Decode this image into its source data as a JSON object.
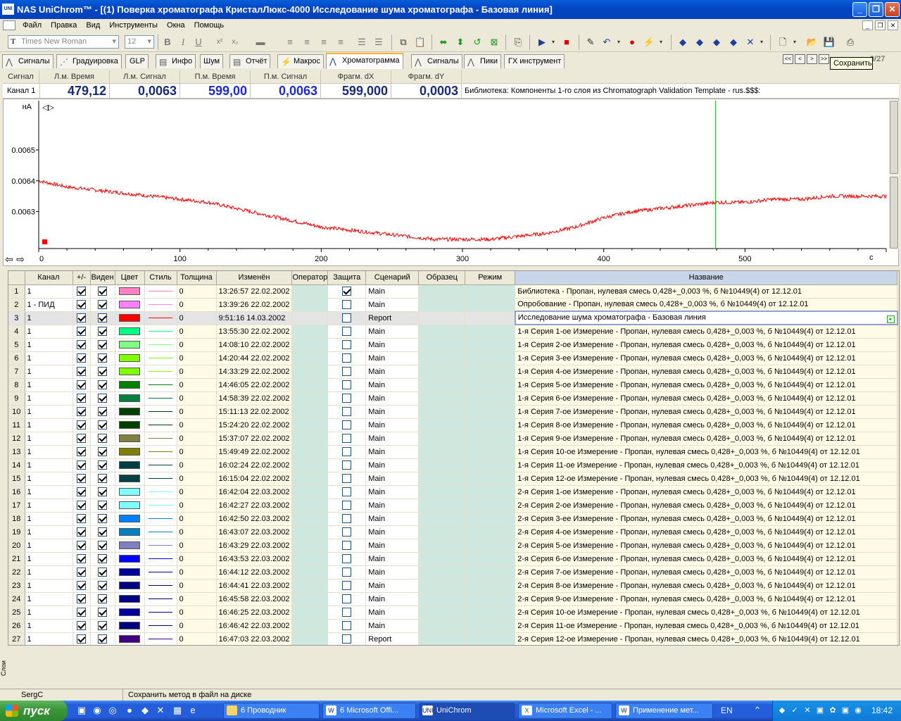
{
  "window": {
    "title": "NAS UniChrom™ - [(1) Поверка хроматографа КристалЛюкс-4000 Исследование шума хроматографа - Базовая линия]",
    "app_icon": "UNI"
  },
  "menu": [
    "Файл",
    "Правка",
    "Вид",
    "Инструменты",
    "Окна",
    "Помощь"
  ],
  "toolbar": {
    "font": "Times New Roman",
    "size": "12"
  },
  "tabs": [
    "Сигналы",
    "Градуировка",
    "GLP",
    "Инфо",
    "Шум",
    "Отчёт",
    "Макрос",
    "Хроматограмма",
    "Сигналы",
    "Пики",
    "ГХ инструмент"
  ],
  "active_tab": "Хроматограмма",
  "nav_buttons": [
    "<<",
    "<",
    ">",
    ">>"
  ],
  "tooltip": "Сохранить",
  "page_indicator": "3/27",
  "info": {
    "headers": [
      "Сигнал",
      "Л.м. Время",
      "Л.м. Сигнал",
      "П.м. Время",
      "П.м. Сигнал",
      "Фрагм. dX",
      "Фрагм. dY"
    ],
    "channel": "Канал 1",
    "lm_time": "479,12",
    "lm_signal": "0,0063",
    "pm_time": "599,00",
    "pm_signal": "0,0063",
    "frag_dx": "599,000",
    "frag_dy": "0,0003",
    "library": "Библиотека: Компоненты 1-го слоя из Chromatograph Validation Template - rus.$$$:"
  },
  "chart_data": {
    "type": "line",
    "ylabel": "нА",
    "xlabel": "c",
    "xlim": [
      0,
      600
    ],
    "ylim": [
      0.00618,
      0.00666
    ],
    "yticks": [
      "0.0065",
      "0.0064",
      "0.0063"
    ],
    "ytick_values": [
      0.0065,
      0.0064,
      0.0063
    ],
    "xticks": [
      "0",
      "100",
      "200",
      "300",
      "400",
      "500"
    ],
    "xtick_values": [
      0,
      100,
      200,
      300,
      400,
      500
    ],
    "cursor_x": 479.12,
    "series": [
      {
        "color": "#ff0000",
        "x": [
          0,
          20,
          40,
          60,
          80,
          100,
          120,
          140,
          160,
          180,
          200,
          220,
          240,
          260,
          280,
          300,
          320,
          340,
          360,
          380,
          400,
          420,
          440,
          460,
          480,
          500,
          520,
          540,
          560,
          580,
          600
        ],
        "y": [
          0.0064,
          0.00638,
          0.00637,
          0.00636,
          0.00635,
          0.00634,
          0.00633,
          0.00631,
          0.00629,
          0.00627,
          0.00625,
          0.00624,
          0.00623,
          0.00622,
          0.00621,
          0.00621,
          0.00621,
          0.00622,
          0.00623,
          0.00625,
          0.00628,
          0.0063,
          0.00631,
          0.00632,
          0.00633,
          0.00633,
          0.00634,
          0.00634,
          0.00635,
          0.00635,
          0.00635
        ]
      }
    ]
  },
  "grid": {
    "headers": [
      "",
      "Канал",
      "+/-",
      "Виден",
      "Цвет",
      "Стиль",
      "Толщина",
      "Изменён",
      "Оператор",
      "Защита",
      "Сценарий",
      "Образец",
      "Режим",
      "Название"
    ],
    "rows": [
      {
        "n": "1",
        "ch": "1",
        "pm": true,
        "vis": true,
        "color": "#ff80c0",
        "w": "0",
        "date": "13:26:57 22.02.2002",
        "prot": true,
        "scen": "Main",
        "name": "Библиотека - Пропан, нулевая смесь 0,428+_0,003 %, б №10449(4) от 12.12.01"
      },
      {
        "n": "2",
        "ch": "1 - ПИД",
        "pm": true,
        "vis": true,
        "color": "#ff80ff",
        "w": "0",
        "date": "13:39:26 22.02.2002",
        "prot": false,
        "scen": "Main",
        "name": "Опробование - Пропан, нулевая смесь 0,428+_0,003 %, б №10449(4) от 12.12.01"
      },
      {
        "n": "3",
        "ch": "1",
        "pm": true,
        "vis": true,
        "color": "#ff0000",
        "w": "0",
        "date": "9:51:16 14.03.2002",
        "prot": false,
        "scen": "Report",
        "name": "Исследование шума хроматографа - Базовая линия"
      },
      {
        "n": "4",
        "ch": "1",
        "pm": true,
        "vis": true,
        "color": "#00ff80",
        "w": "0",
        "date": "13:55:30 22.02.2002",
        "prot": false,
        "scen": "Main",
        "name": "1-я Серия 1-ое Измерение - Пропан, нулевая смесь 0,428+_0,003 %, б №10449(4) от 12.12.01"
      },
      {
        "n": "5",
        "ch": "1",
        "pm": true,
        "vis": true,
        "color": "#80ff80",
        "w": "0",
        "date": "14:08:10 22.02.2002",
        "prot": false,
        "scen": "Main",
        "name": "1-я Серия 2-ое Измерение - Пропан, нулевая смесь 0,428+_0,003 %, б №10449(4) от 12.12.01"
      },
      {
        "n": "6",
        "ch": "1",
        "pm": true,
        "vis": true,
        "color": "#80ff00",
        "w": "0",
        "date": "14:20:44 22.02.2002",
        "prot": false,
        "scen": "Main",
        "name": "1-я Серия 3-ее Измерение - Пропан, нулевая смесь 0,428+_0,003 %, б №10449(4) от 12.12.01"
      },
      {
        "n": "7",
        "ch": "1",
        "pm": true,
        "vis": true,
        "color": "#80ff00",
        "w": "0",
        "date": "14:33:29 22.02.2002",
        "prot": false,
        "scen": "Main",
        "name": "1-я Серия 4-ое Измерение - Пропан, нулевая смесь 0,428+_0,003 %, б №10449(4) от 12.12.01"
      },
      {
        "n": "8",
        "ch": "1",
        "pm": true,
        "vis": true,
        "color": "#008000",
        "w": "0",
        "date": "14:46:05 22.02.2002",
        "prot": false,
        "scen": "Main",
        "name": "1-я Серия 5-ое Измерение - Пропан, нулевая смесь 0,428+_0,003 %, б №10449(4) от 12.12.01"
      },
      {
        "n": "9",
        "ch": "1",
        "pm": true,
        "vis": true,
        "color": "#008040",
        "w": "0",
        "date": "14:58:39 22.02.2002",
        "prot": false,
        "scen": "Main",
        "name": "1-я Серия 6-ое Измерение - Пропан, нулевая смесь 0,428+_0,003 %, б №10449(4) от 12.12.01"
      },
      {
        "n": "10",
        "ch": "1",
        "pm": true,
        "vis": true,
        "color": "#004000",
        "w": "0",
        "date": "15:11:13 22.02.2002",
        "prot": false,
        "scen": "Main",
        "name": "1-я Серия 7-ое Измерение - Пропан, нулевая смесь 0,428+_0,003 %, б №10449(4) от 12.12.01"
      },
      {
        "n": "11",
        "ch": "1",
        "pm": true,
        "vis": true,
        "color": "#004000",
        "w": "0",
        "date": "15:24:20 22.02.2002",
        "prot": false,
        "scen": "Main",
        "name": "1-я Серия 8-ое Измерение - Пропан, нулевая смесь 0,428+_0,003 %, б №10449(4) от 12.12.01"
      },
      {
        "n": "12",
        "ch": "1",
        "pm": true,
        "vis": true,
        "color": "#808040",
        "w": "0",
        "date": "15:37:07 22.02.2002",
        "prot": false,
        "scen": "Main",
        "name": "1-я Серия 9-ое Измерение - Пропан, нулевая смесь 0,428+_0,003 %, б №10449(4) от 12.12.01"
      },
      {
        "n": "13",
        "ch": "1",
        "pm": true,
        "vis": true,
        "color": "#808000",
        "w": "0",
        "date": "15:49:49 22.02.2002",
        "prot": false,
        "scen": "Main",
        "name": "1-я Серия 10-ое Измерение - Пропан, нулевая смесь 0,428+_0,003 %, б №10449(4) от 12.12.01"
      },
      {
        "n": "14",
        "ch": "1",
        "pm": true,
        "vis": true,
        "color": "#004040",
        "w": "0",
        "date": "16:02:24 22.02.2002",
        "prot": false,
        "scen": "Main",
        "name": "1-я Серия 11-ое Измерение - Пропан, нулевая смесь 0,428+_0,003 %, б №10449(4) от 12.12.01"
      },
      {
        "n": "15",
        "ch": "1",
        "pm": true,
        "vis": true,
        "color": "#004040",
        "w": "0",
        "date": "16:15:04 22.02.2002",
        "prot": false,
        "scen": "Main",
        "name": "1-я Серия 12-ое Измерение - Пропан, нулевая смесь 0,428+_0,003 %, б №10449(4) от 12.12.01"
      },
      {
        "n": "16",
        "ch": "1",
        "pm": true,
        "vis": true,
        "color": "#80ffff",
        "w": "0",
        "date": "16:42:04 22.03.2002",
        "prot": false,
        "scen": "Main",
        "name": "2-я Серия 1-ое Измерение - Пропан, нулевая смесь 0,428+_0,003 %, б №10449(4) от 12.12.01"
      },
      {
        "n": "17",
        "ch": "1",
        "pm": true,
        "vis": true,
        "color": "#80ffff",
        "w": "0",
        "date": "16:42:27 22.03.2002",
        "prot": false,
        "scen": "Main",
        "name": "2-я Серия 2-ое Измерение - Пропан, нулевая смесь 0,428+_0,003 %, б №10449(4) от 12.12.01"
      },
      {
        "n": "18",
        "ch": "1",
        "pm": true,
        "vis": true,
        "color": "#0080ff",
        "w": "0",
        "date": "16:42:50 22.03.2002",
        "prot": false,
        "scen": "Main",
        "name": "2-я Серия 3-ее Измерение - Пропан, нулевая смесь 0,428+_0,003 %, б №10449(4) от 12.12.01"
      },
      {
        "n": "19",
        "ch": "1",
        "pm": true,
        "vis": true,
        "color": "#0080c0",
        "w": "0",
        "date": "16:43:07 22.03.2002",
        "prot": false,
        "scen": "Main",
        "name": "2-я Серия 4-ое Измерение - Пропан, нулевая смесь 0,428+_0,003 %, б №10449(4) от 12.12.01"
      },
      {
        "n": "20",
        "ch": "1",
        "pm": true,
        "vis": true,
        "color": "#8080c0",
        "w": "0",
        "date": "16:43:29 22.03.2002",
        "prot": false,
        "scen": "Main",
        "name": "2-я Серия 5-ое Измерение - Пропан, нулевая смесь 0,428+_0,003 %, б №10449(4) от 12.12.01"
      },
      {
        "n": "21",
        "ch": "1",
        "pm": true,
        "vis": true,
        "color": "#0000ff",
        "w": "0",
        "date": "16:43:53 22.03.2002",
        "prot": false,
        "scen": "Main",
        "name": "2-я Серия 6-ое Измерение - Пропан, нулевая смесь 0,428+_0,003 %, б №10449(4) от 12.12.01"
      },
      {
        "n": "22",
        "ch": "1",
        "pm": true,
        "vis": true,
        "color": "#0000a0",
        "w": "0",
        "date": "16:44:12 22.03.2002",
        "prot": false,
        "scen": "Main",
        "name": "2-я Серия 7-ое Измерение - Пропан, нулевая смесь 0,428+_0,003 %, б №10449(4) от 12.12.01"
      },
      {
        "n": "23",
        "ch": "1",
        "pm": true,
        "vis": true,
        "color": "#000080",
        "w": "0",
        "date": "16:44:41 22.03.2002",
        "prot": false,
        "scen": "Main",
        "name": "2-я Серия 8-ое Измерение - Пропан, нулевая смесь 0,428+_0,003 %, б №10449(4) от 12.12.01"
      },
      {
        "n": "24",
        "ch": "1",
        "pm": true,
        "vis": true,
        "color": "#000080",
        "w": "0",
        "date": "16:45:58 22.03.2002",
        "prot": false,
        "scen": "Main",
        "name": "2-я Серия 9-ое Измерение - Пропан, нулевая смесь 0,428+_0,003 %, б №10449(4) от 12.12.01"
      },
      {
        "n": "25",
        "ch": "1",
        "pm": true,
        "vis": true,
        "color": "#0000a0",
        "w": "0",
        "date": "16:46:25 22.03.2002",
        "prot": false,
        "scen": "Main",
        "name": "2-я Серия 10-ое Измерение - Пропан, нулевая смесь 0,428+_0,003 %, б №10449(4) от 12.12.01"
      },
      {
        "n": "26",
        "ch": "1",
        "pm": true,
        "vis": true,
        "color": "#000080",
        "w": "0",
        "date": "16:46:42 22.03.2002",
        "prot": false,
        "scen": "Main",
        "name": "2-я Серия 11-ое Измерение - Пропан, нулевая смесь 0,428+_0,003 %, б №10449(4) от 12.12.01"
      },
      {
        "n": "27",
        "ch": "1",
        "pm": true,
        "vis": true,
        "color": "#400080",
        "w": "0",
        "date": "16:47:03 22.03.2002",
        "prot": false,
        "scen": "Report",
        "name": "2-я Серия 12-ое Измерение - Пропан, нулевая смесь 0,428+_0,003 %, б №10449(4) от 12.12.01"
      }
    ]
  },
  "side_label": "Слои",
  "status": {
    "user": "SergC",
    "message": "Сохранить метод в файл на диске"
  },
  "taskbar": {
    "start": "пуск",
    "tasks": [
      "6 Проводник",
      "6 Microsoft Offi...",
      "UniChrom",
      "Microsoft Excel - ...",
      "Применение мет..."
    ],
    "active_task": "UniChrom",
    "lang": "EN",
    "clock": "18:42"
  }
}
